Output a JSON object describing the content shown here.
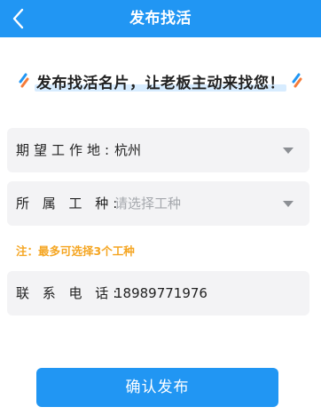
{
  "header": {
    "title": "发布找活",
    "back_icon": "chevron-left-icon"
  },
  "slogan": {
    "text": "发布找活名片，让老板主动来找您！",
    "accent_icon": "slash-decoration-icon"
  },
  "form": {
    "workplace": {
      "label": "期望工作地:",
      "value": "杭州"
    },
    "job_type": {
      "label": "所 属 工 种:",
      "placeholder": "请选择工种"
    },
    "note": "注：最多可选择3个工种",
    "phone": {
      "label": "联 系 电 话:",
      "value": "18989771976"
    }
  },
  "submit": {
    "label": "确认发布"
  },
  "colors": {
    "primary": "#2196f3",
    "note": "#f5a623",
    "card_background": "#f3f3f5",
    "placeholder": "#a5a8ad"
  }
}
